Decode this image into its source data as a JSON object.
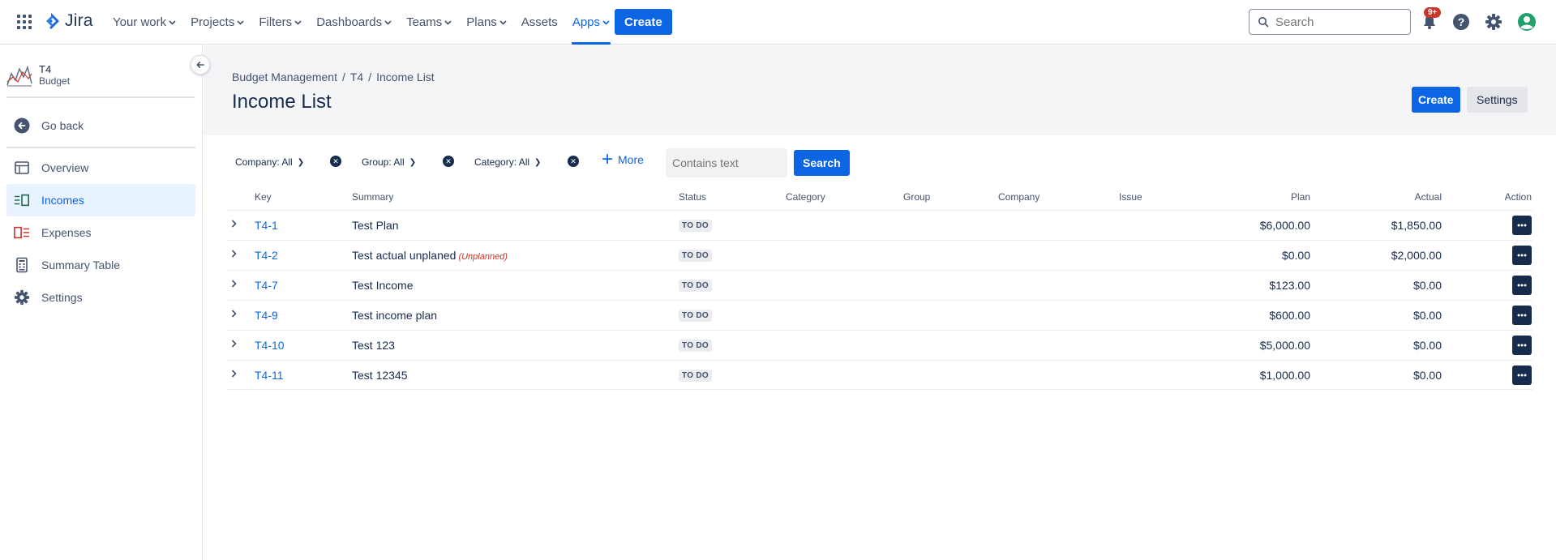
{
  "topnav": {
    "logo": "Jira",
    "items": [
      {
        "label": "Your work",
        "chevron": true,
        "active": false
      },
      {
        "label": "Projects",
        "chevron": true,
        "active": false
      },
      {
        "label": "Filters",
        "chevron": true,
        "active": false
      },
      {
        "label": "Dashboards",
        "chevron": true,
        "active": false
      },
      {
        "label": "Teams",
        "chevron": true,
        "active": false
      },
      {
        "label": "Plans",
        "chevron": true,
        "active": false
      },
      {
        "label": "Assets",
        "chevron": false,
        "active": false
      },
      {
        "label": "Apps",
        "chevron": true,
        "active": true
      }
    ],
    "create_label": "Create",
    "search_placeholder": "Search",
    "notif_badge": "9+",
    "icons": [
      "apps-grid-icon",
      "jira-logo-icon",
      "search-icon",
      "bell-icon",
      "help-icon",
      "gear-icon",
      "avatar-icon"
    ]
  },
  "sidebar": {
    "project_name": "T4",
    "project_sub": "Budget",
    "go_back": "Go back",
    "items": [
      {
        "label": "Overview",
        "icon": "overview-icon",
        "active": false
      },
      {
        "label": "Incomes",
        "icon": "incomes-icon",
        "active": true
      },
      {
        "label": "Expenses",
        "icon": "expenses-icon",
        "active": false
      },
      {
        "label": "Summary Table",
        "icon": "summary-table-icon",
        "active": false
      },
      {
        "label": "Settings",
        "icon": "gear-icon",
        "active": false
      }
    ]
  },
  "header": {
    "breadcrumb": [
      "Budget Management",
      "T4",
      "Income List"
    ],
    "title": "Income List",
    "create_label": "Create",
    "settings_label": "Settings"
  },
  "filters": {
    "company": "Company: All",
    "group": "Group: All",
    "category": "Category: All",
    "more": "More",
    "text_placeholder": "Contains text",
    "search_label": "Search"
  },
  "table": {
    "columns": [
      "Key",
      "Summary",
      "Status",
      "Category",
      "Group",
      "Company",
      "Issue",
      "Plan",
      "Actual",
      "Action"
    ],
    "rows": [
      {
        "key": "T4-1",
        "summary": "Test Plan",
        "unplanned": "",
        "status": "TO DO",
        "plan": "$6,000.00",
        "actual": "$1,850.00"
      },
      {
        "key": "T4-2",
        "summary": "Test actual unplaned",
        "unplanned": "(Unplanned)",
        "status": "TO DO",
        "plan": "$0.00",
        "actual": "$2,000.00"
      },
      {
        "key": "T4-7",
        "summary": "Test Income",
        "unplanned": "",
        "status": "TO DO",
        "plan": "$123.00",
        "actual": "$0.00"
      },
      {
        "key": "T4-9",
        "summary": "Test income plan",
        "unplanned": "",
        "status": "TO DO",
        "plan": "$600.00",
        "actual": "$0.00"
      },
      {
        "key": "T4-10",
        "summary": "Test 123",
        "unplanned": "",
        "status": "TO DO",
        "plan": "$5,000.00",
        "actual": "$0.00"
      },
      {
        "key": "T4-11",
        "summary": "Test 12345",
        "unplanned": "",
        "status": "TO DO",
        "plan": "$1,000.00",
        "actual": "$0.00"
      }
    ]
  },
  "colors": {
    "accent": "#0c66e4",
    "text": "#172b4d",
    "muted": "#44546f",
    "danger": "#c9372c",
    "avatar": "#22a06b"
  }
}
